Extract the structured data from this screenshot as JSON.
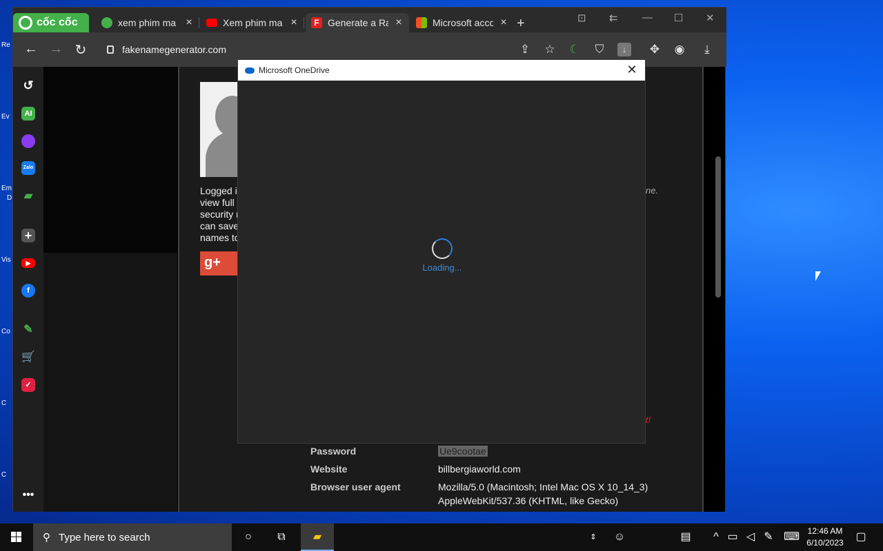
{
  "browser": {
    "brand": "cốc cốc",
    "tabs": [
      {
        "label": "xem phim ma",
        "favicon": "coccoc-tab-icon",
        "color": "#43b04a"
      },
      {
        "label": "Xem phim ma",
        "favicon": "youtube-icon",
        "color": "#ff0000"
      },
      {
        "label": "Generate a Ran",
        "favicon": "fakenamegenerator-icon",
        "color": "#e02020",
        "active": true
      },
      {
        "label": "Microsoft acco",
        "favicon": "microsoft-icon",
        "color": "#f25022"
      }
    ],
    "url": "fakenamegenerator.com",
    "sidebar": [
      {
        "name": "history-icon"
      },
      {
        "name": "ai-icon",
        "text": "AI"
      },
      {
        "name": "messenger-icon"
      },
      {
        "name": "zalo-icon",
        "text": "Zalo"
      },
      {
        "name": "game-icon"
      },
      {
        "name": "add-icon"
      },
      {
        "name": "youtube-icon"
      },
      {
        "name": "facebook-icon"
      },
      {
        "name": "coccoc-icon"
      },
      {
        "name": "shopping-icon"
      },
      {
        "name": "todo-icon"
      },
      {
        "name": "more-icon"
      }
    ]
  },
  "page": {
    "logged_text": [
      "Logged in",
      "view full s",
      "security r",
      "can save",
      "names to"
    ],
    "right_italic": "ne.",
    "right_italic_red": "t!",
    "info": [
      {
        "label": "Password",
        "value": "Ue9cootae"
      },
      {
        "label": "Website",
        "value": "billbergiaworld.com"
      },
      {
        "label": "Browser user agent",
        "value": "Mozilla/5.0 (Macintosh; Intel Mac OS X 10_14_3) AppleWebKit/537.36 (KHTML, like Gecko)"
      }
    ]
  },
  "dialog": {
    "title": "Microsoft OneDrive",
    "loading": "Loading..."
  },
  "taskbar": {
    "search_placeholder": "Type here to search",
    "time": "12:46 AM",
    "date": "6/10/2023"
  },
  "desktop": {
    "icon_labels": [
      "Re",
      "Ev",
      "Em",
      "D",
      "Vis",
      "Co",
      "C",
      "C"
    ]
  }
}
